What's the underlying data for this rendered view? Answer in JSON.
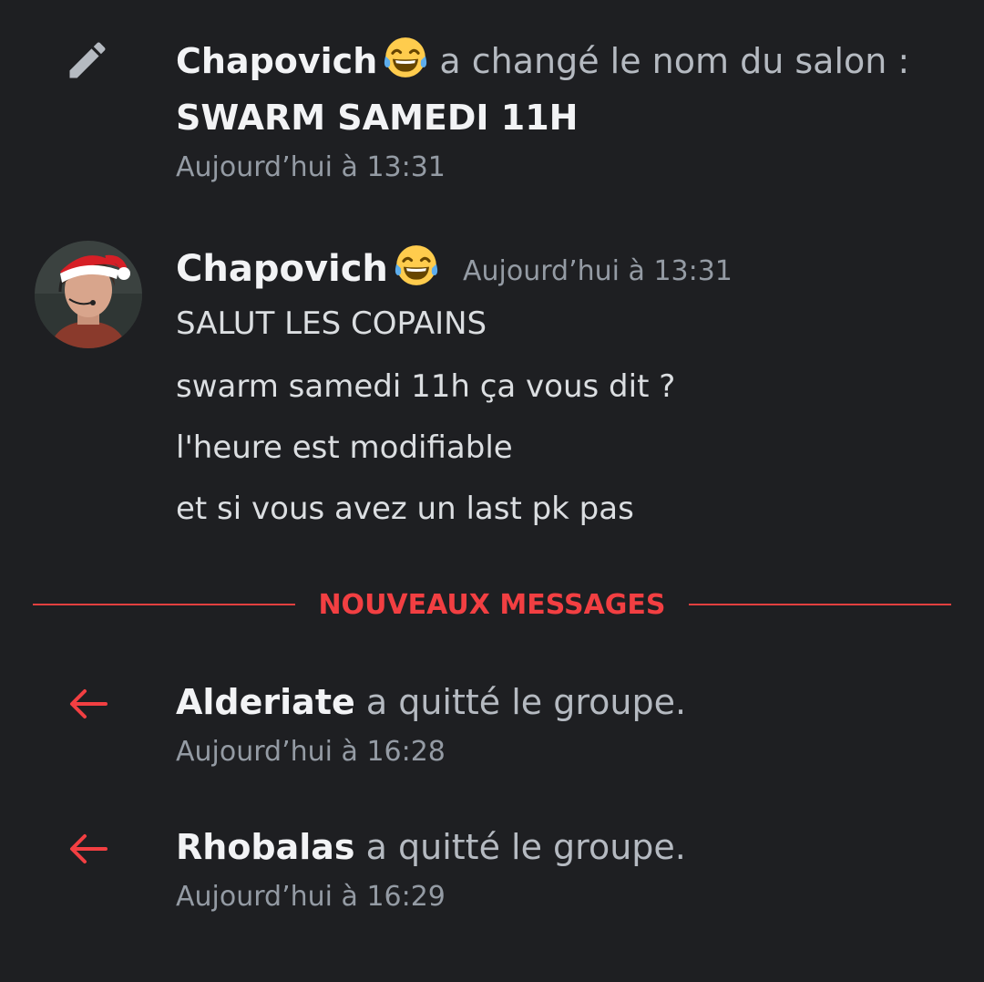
{
  "icons": {
    "rename": "pencil-icon",
    "leave": "arrow-left-icon",
    "emoji": "joy-emoji",
    "avatar": "user-avatar-santa-hat"
  },
  "colors": {
    "background": "#1e1f22",
    "new_messages_red": "#f23f42",
    "timestamp": "#949ba4"
  },
  "rename_event": {
    "user": "Chapovich",
    "action": "a changé le nom du salon :",
    "channel_name": "SWARM SAMEDI 11H",
    "timestamp": "Aujourd’hui à 13:31"
  },
  "message": {
    "author": "Chapovich",
    "timestamp": "Aujourd’hui à 13:31",
    "lines": [
      "SALUT LES COPAINS",
      "swarm samedi 11h ça vous dit ?",
      "l'heure est modifiable",
      "et si vous avez un last pk pas"
    ]
  },
  "divider": {
    "label": "NOUVEAUX MESSAGES"
  },
  "leave_events": [
    {
      "user": "Alderiate",
      "action": "a quitté le groupe.",
      "timestamp": "Aujourd’hui à 16:28"
    },
    {
      "user": "Rhobalas",
      "action": "a quitté le groupe.",
      "timestamp": "Aujourd’hui à 16:29"
    }
  ]
}
